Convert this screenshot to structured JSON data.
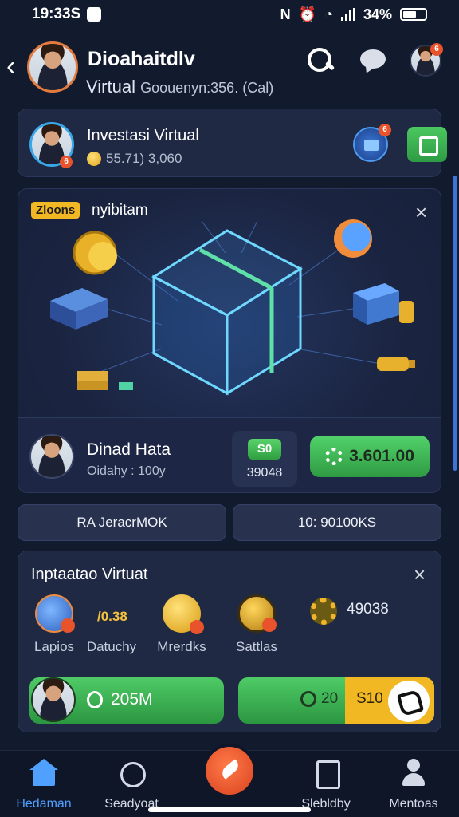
{
  "status_bar": {
    "time": "19:33S",
    "battery": "34%"
  },
  "header": {
    "title": "Dioahaitdlv",
    "subtitle": "Virtual",
    "subtitle_extra": "Goouenyn:356. (Cal)"
  },
  "account": {
    "name": "Investasi Virtual",
    "balance": "55.71) 3,060"
  },
  "promo": {
    "badge": "Zloons",
    "title": "nyibitam",
    "close": "×"
  },
  "person": {
    "name": "Dinad Hata",
    "sub": "Oidahy : 100y",
    "mini_chip": "S0",
    "mini_value": "39048",
    "cta_label": "3.601.00"
  },
  "tabs": {
    "left": "RA JeracrMOK",
    "right": "10: 90100KS"
  },
  "invest": {
    "title": "Inptaatao Virtuat",
    "close": "×",
    "features": [
      {
        "label": "Lapios",
        "icon": "laptop-icon"
      },
      {
        "label": "Datuchy",
        "icon": "daily-icon",
        "value": "/0.38"
      },
      {
        "label": "Mrerdks",
        "icon": "coin-icon"
      },
      {
        "label": "Sattlas",
        "icon": "savings-icon"
      }
    ],
    "gear_value": "49038",
    "pill_left_value": "205M",
    "pill_right_green": "20",
    "pill_right_gold": "S10"
  },
  "nav": {
    "home": "Hedaman",
    "search": "Seadyoat",
    "stats": "Slebldby",
    "profile": "Mentoas"
  }
}
